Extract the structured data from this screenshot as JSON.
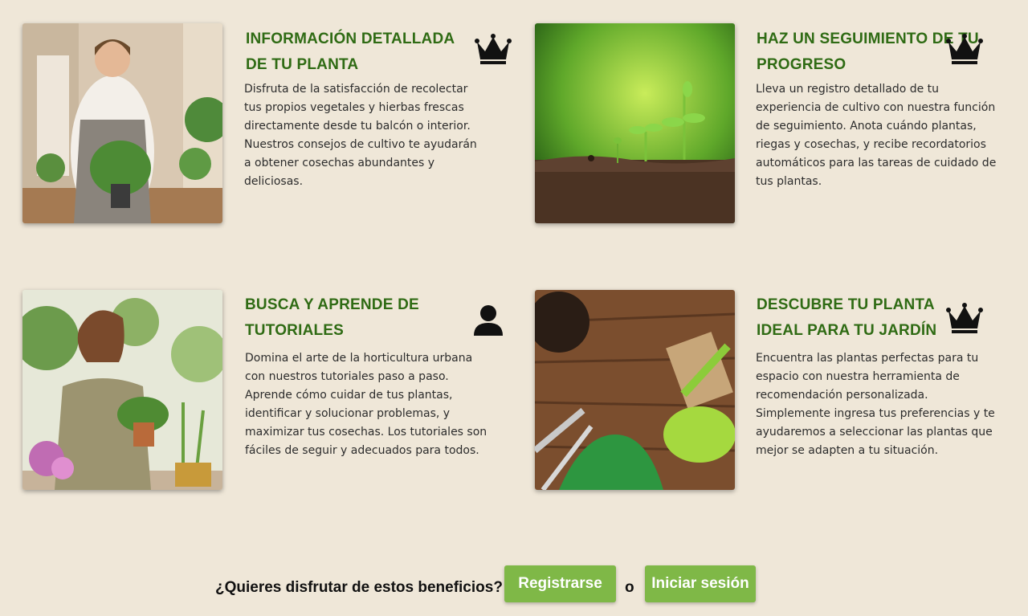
{
  "features": [
    {
      "title": "INFORMACIÓN DETALLADA DE TU PLANTA",
      "description": "Disfruta de la satisfacción de recolectar tus propios vegetales y hierbas frescas directamente desde tu balcón o interior. Nuestros consejos de cultivo te ayudarán a obtener cosechas abundantes y deliciosas.",
      "badge_icon": "crown-icon",
      "image": "woman-holding-plant-photo"
    },
    {
      "title": "HAZ UN SEGUIMIENTO DE TU PROGRESO",
      "description": "Lleva un registro detallado de tu experiencia de cultivo con nuestra función de seguimiento. Anota cuándo plantas, riegas y cosechas, y recibe recordatorios automáticos para las tareas de cuidado de tus plantas.",
      "badge_icon": "crown-icon",
      "image": "seedlings-growing-photo"
    },
    {
      "title": "BUSCA Y APRENDE DE TUTORIALES",
      "description": "Domina el arte de la horticultura urbana con nuestros tutoriales paso a paso. Aprende cómo cuidar de tus plantas, identificar y solucionar problemas, y maximizar tus cosechas. Los tutoriales son fáciles de seguir y adecuados para todos.",
      "badge_icon": "user-icon",
      "image": "woman-potting-plant-photo"
    },
    {
      "title": "DESCUBRE TU PLANTA IDEAL PARA TU JARDÍN",
      "description": "Encuentra las plantas perfectas para tu espacio con nuestra herramienta de recomendación personalizada. Simplemente ingresa tus preferencias y te ayudaremos a seleccionar las plantas que mejor se adapten a tu situación.",
      "badge_icon": "crown-icon",
      "image": "garden-tools-photo"
    }
  ],
  "cta": {
    "question": "¿Quieres disfrutar de estos beneficios?",
    "register_label": "Registrarse",
    "or_label": "o",
    "login_label": "Iniciar sesión"
  },
  "colors": {
    "background": "#efe7d8",
    "title_green": "#2f6b14",
    "button_green": "#7fb847"
  }
}
